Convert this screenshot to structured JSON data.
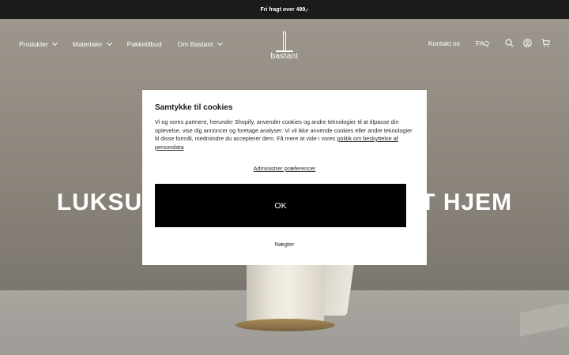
{
  "announcement": "Fri fragt over 499,-",
  "nav": {
    "left": [
      {
        "label": "Produkter",
        "has_dropdown": true
      },
      {
        "label": "Materialer",
        "has_dropdown": true
      },
      {
        "label": "Pakketilbud",
        "has_dropdown": false
      },
      {
        "label": "Om Bastant",
        "has_dropdown": true
      }
    ],
    "logo_text": "bastant",
    "right": {
      "contact": "Kontakt os",
      "faq": "FAQ",
      "icons": [
        "search-icon",
        "account-icon",
        "cart-icon"
      ]
    }
  },
  "hero": {
    "title_left": "LUKSU",
    "title_right": "T HJEM"
  },
  "cookie_modal": {
    "title": "Samtykke til cookies",
    "body": "Vi og vores partnere, herunder Shopify, anvender cookies og andre teknologier til at tilpasse din oplevelse, vise dig annoncer og foretage analyser. Vi vil ikke anvende cookies eller andre teknologier til disse formål, medmindre du accepterer dem. Få mere at vide i vores ",
    "policy_link": "politik om beskyttelse af persondata",
    "preferences_link": "Administrer præferencer",
    "ok_button": "OK",
    "decline_button": "Nægter"
  },
  "colors": {
    "announcement_bg": "#1b1b1b",
    "button_bg": "#000000",
    "modal_bg": "#ffffff"
  }
}
